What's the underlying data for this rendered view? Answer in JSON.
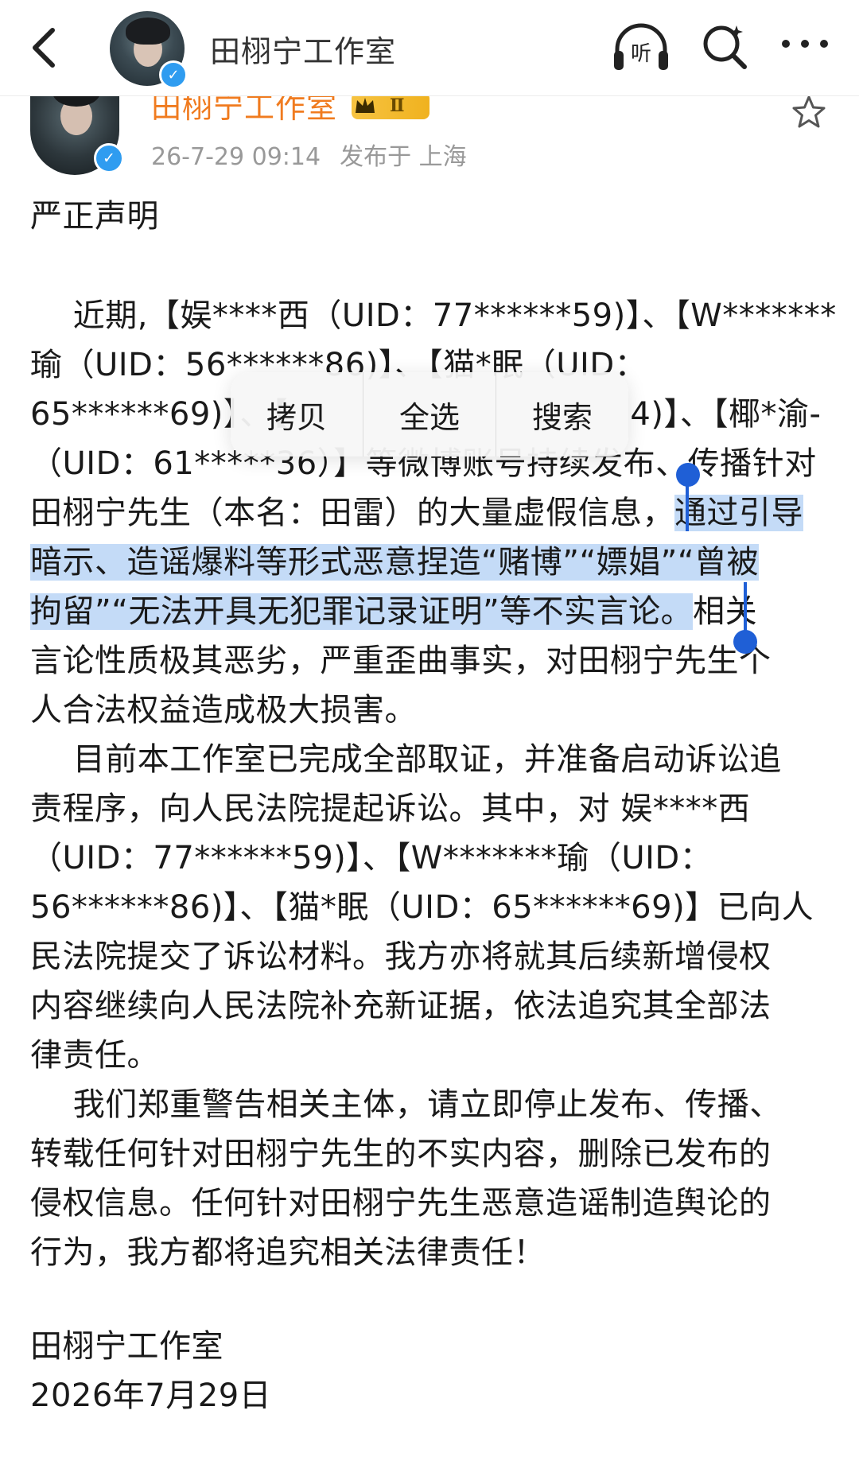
{
  "header": {
    "title": "田栩宁工作室",
    "icons": [
      "back-icon",
      "listen-icon",
      "search-icon",
      "more-icon"
    ],
    "listen_label": "听"
  },
  "post": {
    "author": "田栩宁工作室",
    "badge_level": "Ⅱ",
    "time": "26-7-29 09:14",
    "location": "发布于 上海",
    "accent_color": "#f07b1f",
    "verified_color": "#2f9cf0"
  },
  "body": {
    "heading": "严正声明",
    "p1_l1": "　 近期,【娱****西（UID：77******59)】、【W*******",
    "p1_l2": "瑜（UID：56******86)】、【猫*眠（UID：",
    "p1_l3": "65******69)】、【",
    "p1_l3b": "4)】、【椰*渝-",
    "p1_l4": "（UID：61*****36）】等微博账号持续发布、传播针对",
    "p1_l5a": "田栩宁先生（本名：田雷）的大量虚假信息，",
    "p1_l5b": "通过引导",
    "p1_l6": "暗示、造谣爆料等形式恶意捏造“赌博”“嫖娼”“曾被",
    "p1_l7a": "拘留”“无法开具无犯罪记录证明”等不实言论。",
    "p1_l7b": "相关",
    "p1_l8": "言论性质极其恶劣，严重歪曲事实，对田栩宁先生个",
    "p1_l9": "人合法权益造成极大损害。",
    "p2_l1": "　 目前本工作室已完成全部取证，并准备启动诉讼追",
    "p2_l2": "责程序，向人民法院提起诉讼。其中，对 娱****西",
    "p2_l3": "（UID：77******59)】、【W*******瑜（UID：",
    "p2_l4": "56******86)】、【猫*眠（UID：65******69)】已向人",
    "p2_l5": "民法院提交了诉讼材料。我方亦将就其后续新增侵权",
    "p2_l6": "内容继续向人民法院补充新证据，依法追究其全部法",
    "p2_l7": "律责任。",
    "p3_l1": "　 我们郑重警告相关主体，请立即停止发布、传播、",
    "p3_l2": "转载任何针对田栩宁先生的不实内容，删除已发布的",
    "p3_l3": "侵权信息。任何针对田栩宁先生恶意造谣制造舆论的",
    "p3_l4": "行为，我方都将追究相关法律责任！",
    "signature": "田栩宁工作室",
    "date": "2026年7月29日"
  },
  "context_menu": {
    "copy": "拷贝",
    "select_all": "全选",
    "search": "搜索"
  },
  "selection_color": "#c4dbf7",
  "handle_color": "#1f5fd6"
}
